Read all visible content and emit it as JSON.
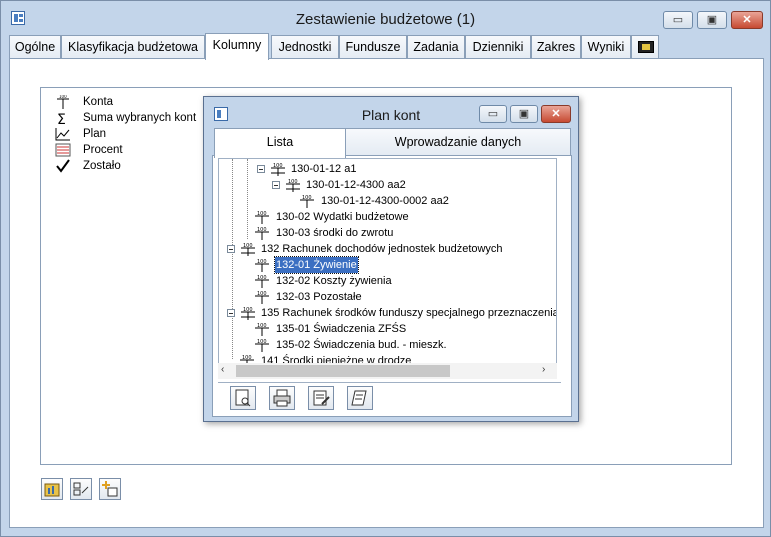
{
  "window": {
    "title": "Zestawienie budżetowe (1)",
    "minimize_label": "▭",
    "maximize_label": "▣",
    "close_label": "✕"
  },
  "tabs": [
    {
      "label": "Ogólne"
    },
    {
      "label": "Klasyfikacja budżetowa"
    },
    {
      "label": "Kolumny"
    },
    {
      "label": "Jednostki"
    },
    {
      "label": "Fundusze"
    },
    {
      "label": "Zadania"
    },
    {
      "label": "Dzienniki"
    },
    {
      "label": "Zakres"
    },
    {
      "label": "Wyniki"
    }
  ],
  "legend": [
    {
      "label": "Konta",
      "icon": "account-icon"
    },
    {
      "label": "Suma wybranych kont",
      "icon": "sigma-icon"
    },
    {
      "label": "Plan",
      "icon": "chart-icon"
    },
    {
      "label": "Procent",
      "icon": "percent-icon"
    },
    {
      "label": "Zostało",
      "icon": "check-icon"
    }
  ],
  "dialog": {
    "title": "Plan kont",
    "tab_list": "Lista",
    "tab_entry": "Wprowadzanie danych",
    "tree": [
      {
        "label": "130-01-12 a1",
        "expanded": true
      },
      {
        "label": "130-01-12-4300 aa2",
        "expanded": true
      },
      {
        "label": "130-01-12-4300-0002 aa2"
      },
      {
        "label": "130-02 Wydatki budżetowe"
      },
      {
        "label": "130-03 środki do zwrotu"
      },
      {
        "label": "132 Rachunek dochodów  jednostek budżetowych",
        "expanded": true
      },
      {
        "label": "132-01 Żywienie",
        "selected": true
      },
      {
        "label": "132-02 Koszty żywienia"
      },
      {
        "label": "132-03 Pozostałe"
      },
      {
        "label": "135 Rachunek środków funduszy specjalnego przeznaczenia",
        "expanded": true
      },
      {
        "label": "135-01 Świadczenia ZFŚS"
      },
      {
        "label": "135-02 Świadczenia bud. - mieszk."
      },
      {
        "label": "141 Środki pieniężne w drodze"
      }
    ]
  },
  "colors": {
    "selection": "#3b6fc2",
    "frame": "#c3d5ea",
    "close": "#c74a32"
  }
}
